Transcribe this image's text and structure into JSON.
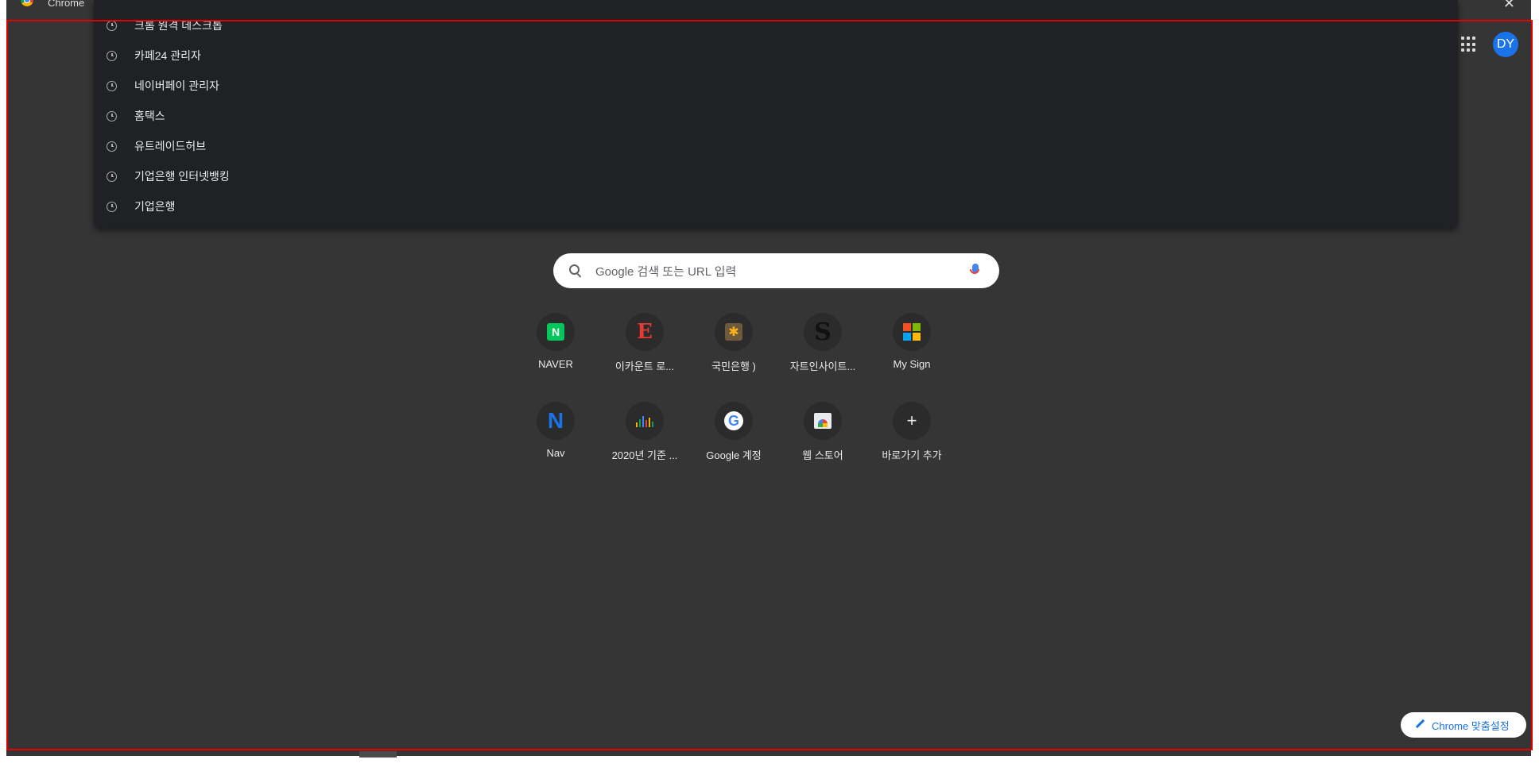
{
  "window": {
    "title": "Chrome",
    "close_glyph": "✕"
  },
  "header": {
    "apps_icon": "apps-grid-icon",
    "avatar_initials": "DY"
  },
  "omnibox_dropdown": {
    "suggestions": [
      {
        "label": "크롬 원격 데스크톱",
        "icon": "history-clock-icon"
      },
      {
        "label": "카페24 관리자",
        "icon": "history-clock-icon"
      },
      {
        "label": "네이버페이 관리자",
        "icon": "history-clock-icon"
      },
      {
        "label": "홈택스",
        "icon": "history-clock-icon"
      },
      {
        "label": "유트레이드허브",
        "icon": "history-clock-icon"
      },
      {
        "label": "기업은행 인터넷뱅킹",
        "icon": "history-clock-icon"
      },
      {
        "label": "기업은행",
        "icon": "history-clock-icon"
      }
    ]
  },
  "search": {
    "placeholder": "Google 검색 또는 URL 입력",
    "icon": "search-icon",
    "mic_icon": "microphone-icon"
  },
  "shortcuts": [
    {
      "label": "NAVER",
      "icon": "naver-icon"
    },
    {
      "label": "이카운트 로...",
      "icon": "ecount-icon"
    },
    {
      "label": "국민은행 )",
      "icon": "kb-bank-icon"
    },
    {
      "label": "자트인사이트...",
      "icon": "s-logo-icon"
    },
    {
      "label": "My Sign",
      "icon": "microsoft-icon"
    },
    {
      "label": "Nav",
      "icon": "nav-n-icon"
    },
    {
      "label": "2020년 기준 ...",
      "icon": "bar-chart-icon"
    },
    {
      "label": "Google 계정",
      "icon": "google-icon"
    },
    {
      "label": "웹 스토어",
      "icon": "web-store-icon"
    },
    {
      "label": "바로가기 추가",
      "icon": "plus-icon"
    }
  ],
  "customize_button": {
    "label": "Chrome 맞춤설정",
    "icon": "pencil-icon"
  },
  "colors": {
    "page_background": "#353535",
    "dropdown_background": "#202124",
    "accent": "#1a73e8",
    "highlight_border": "#e00000"
  }
}
